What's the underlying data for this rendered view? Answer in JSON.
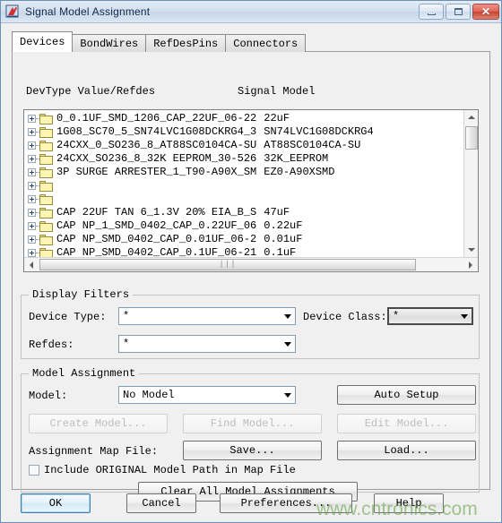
{
  "window": {
    "title": "Signal Model Assignment",
    "icon": "app-icon",
    "buttons": {
      "minimize": "minimize-icon",
      "maximize": "maximize-icon",
      "close": "close-icon"
    }
  },
  "tabs": [
    {
      "label": "Devices",
      "active": true
    },
    {
      "label": "BondWires",
      "active": false
    },
    {
      "label": "RefDesPins",
      "active": false
    },
    {
      "label": "Connectors",
      "active": false
    }
  ],
  "list": {
    "headers": {
      "left": "DevType Value/Refdes",
      "right": "Signal Model"
    },
    "rows": [
      {
        "dev": "0_0.1UF_SMD_1206_CAP_22UF_06-22",
        "model": "22uF",
        "faint": false
      },
      {
        "dev": "1G08_SC70_5_SN74LVC1G08DCKRG4_3",
        "model": "SN74LVC1G08DCKRG4",
        "faint": false
      },
      {
        "dev": "24CXX_0_SO236_8_AT88SC0104CA-SU",
        "model": "AT88SC0104CA-SU",
        "faint": false
      },
      {
        "dev": "24CXX_SO236_8_32K EEPROM_30-526",
        "model": "32K_EEPROM",
        "faint": false
      },
      {
        "dev": "3P SURGE ARRESTER_1_T90-A90X_SM",
        "model": "EZ0-A90XSMD",
        "faint": false
      },
      {
        "dev": "",
        "model": "",
        "faint": true
      },
      {
        "dev": "",
        "model": "",
        "faint": true
      },
      {
        "dev": "CAP 22UF TAN 6_1.3V 20% EIA_B_S",
        "model": "47uF",
        "faint": false
      },
      {
        "dev": "CAP NP_1_SMD_0402_CAP_0.22UF_06",
        "model": "0.22uF",
        "faint": false
      },
      {
        "dev": "CAP NP_SMD_0402_CAP_0.01UF_06-2",
        "model": "0.01uF",
        "faint": false
      },
      {
        "dev": "CAP NP_SMD_0402_CAP_0.1UF_06-21",
        "model": "0.1uF",
        "faint": false
      }
    ],
    "scrollbars": {
      "vertical_up": "scroll-up-icon",
      "vertical_down": "scroll-down-icon",
      "horizontal_left": "scroll-left-icon",
      "horizontal_right": "scroll-right-icon",
      "grip": "|||"
    }
  },
  "display_filters": {
    "legend": "Display Filters",
    "device_type_label": "Device Type:",
    "device_type_value": "*",
    "device_class_label": "Device Class:",
    "device_class_value": "*",
    "refdes_label": "Refdes:",
    "refdes_value": "*"
  },
  "model_assignment": {
    "legend": "Model Assignment",
    "model_label": "Model:",
    "model_value": "No Model",
    "auto_setup": "Auto Setup",
    "create_model": "Create Model...",
    "find_model": "Find Model...",
    "edit_model": "Edit Model...",
    "map_file_label": "Assignment Map File:",
    "save": "Save...",
    "load": "Load...",
    "include_original": "Include ORIGINAL Model Path in Map File",
    "include_original_checked": false,
    "clear_all": "Clear All Model Assignments"
  },
  "footer": {
    "ok": "OK",
    "cancel": "Cancel",
    "preferences": "Preferences...",
    "help": "Help"
  },
  "watermark": {
    "text": "www.cntronics.com",
    "color": "#6aa84f"
  }
}
